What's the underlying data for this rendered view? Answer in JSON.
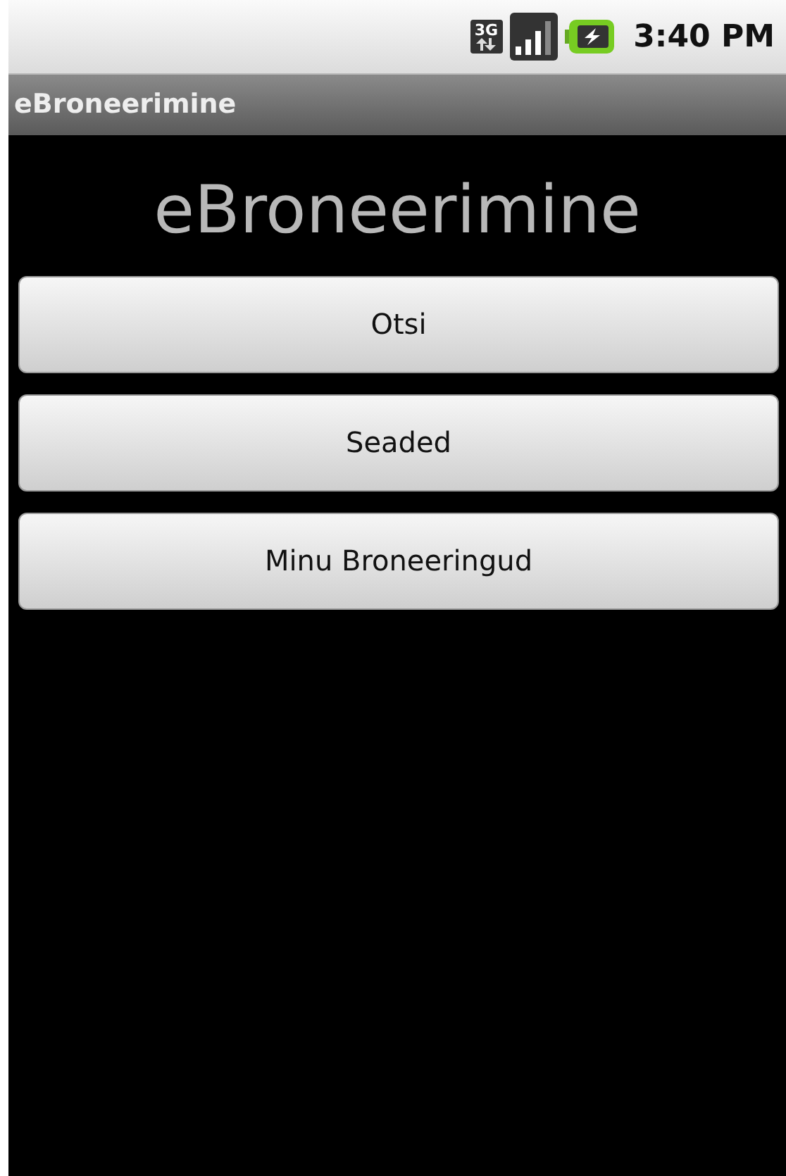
{
  "status_bar": {
    "network_type": "3G",
    "time": "3:40 PM"
  },
  "title_bar": {
    "title": "eBroneerimine"
  },
  "heading": "eBroneerimine",
  "buttons": [
    {
      "label": "Otsi"
    },
    {
      "label": "Seaded"
    },
    {
      "label": "Minu Broneeringud"
    }
  ]
}
